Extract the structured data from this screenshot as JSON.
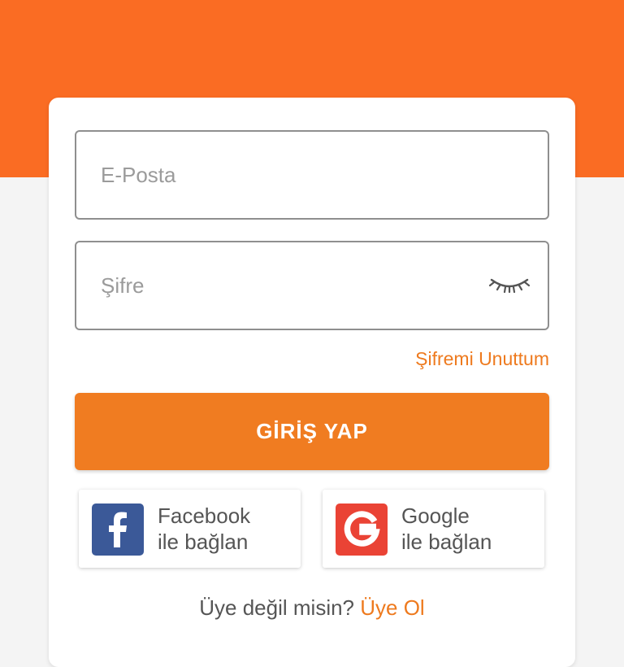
{
  "colors": {
    "header_band": "#fa6c23",
    "accent": "#f07c21",
    "link": "#ee7a1e",
    "facebook": "#3b5998",
    "google": "#ea4335"
  },
  "login_form": {
    "email_placeholder": "E-Posta",
    "password_placeholder": "Şifre",
    "password_toggle_icon": "eye-closed-icon",
    "forgot_password_label": "Şifremi Unuttum",
    "submit_label": "GİRİŞ YAP"
  },
  "social_login": {
    "facebook": {
      "icon": "facebook-icon",
      "line1": "Facebook",
      "line2": "ile bağlan"
    },
    "google": {
      "icon": "google-icon",
      "line1": "Google",
      "line2": "ile bağlan"
    }
  },
  "signup": {
    "prompt": "Üye değil misin?",
    "link_label": "Üye Ol"
  }
}
